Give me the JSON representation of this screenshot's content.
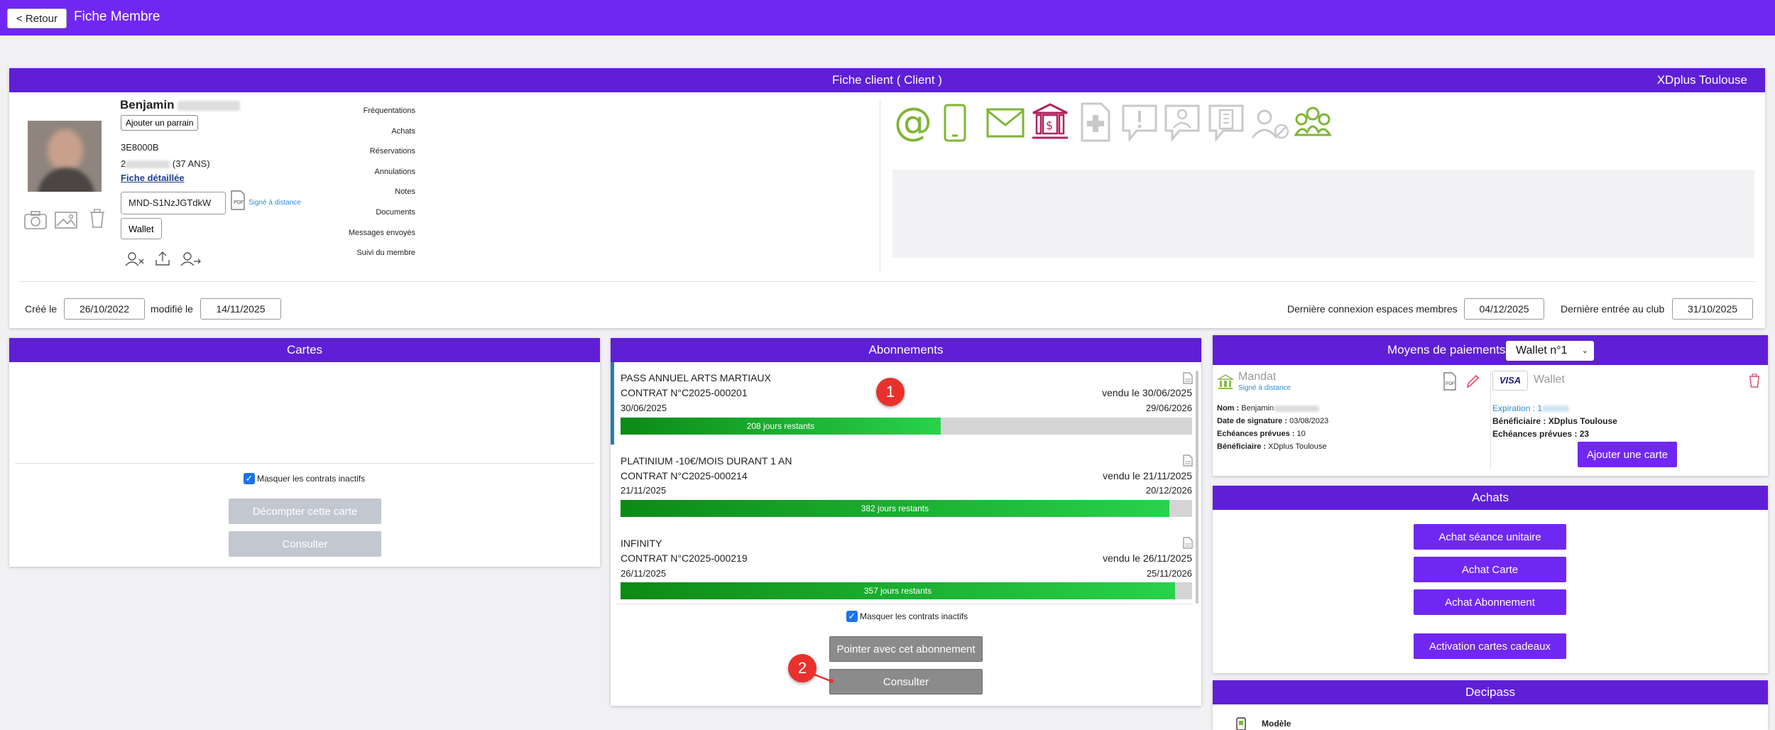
{
  "topbar": {
    "back_label": "< Retour",
    "title": "Fiche Membre"
  },
  "fiche": {
    "header": "Fiche client ( Client )",
    "club": "XDplus Toulouse",
    "name": "Benjamin",
    "parrain_label": "Ajouter un parrain",
    "code": "3E8000B",
    "birth_prefix": "2",
    "age": "(37 ANS)",
    "detail_link": "Fiche détaillée",
    "mandate_ref": "MND-S1NzJGTdkW",
    "signed_label": "Signé à distance",
    "wallet_label": "Wallet",
    "menu": [
      "Fréquentations",
      "Achats",
      "Réservations",
      "Annulations",
      "Notes",
      "Documents",
      "Messages envoyés",
      "Suivi du membre"
    ],
    "created_label": "Créé le",
    "created_date": "26/10/2022",
    "modified_label": "modifié le",
    "modified_date": "14/11/2025",
    "last_login_label": "Dernière connexion espaces membres",
    "last_login_date": "04/12/2025",
    "last_entry_label": "Dernière entrée au club",
    "last_entry_date": "31/10/2025",
    "contact_icons": [
      {
        "name": "email-icon",
        "color": "#7fb536"
      },
      {
        "name": "phone-icon",
        "color": "#7fb536"
      },
      {
        "name": "mail-icon",
        "color": "#7fb536"
      },
      {
        "name": "bank-icon",
        "color": "#b0245e"
      },
      {
        "name": "medical-doc-icon",
        "color": "#c9c9c9"
      },
      {
        "name": "alert-icon",
        "color": "#c9c9c9"
      },
      {
        "name": "contact-icon",
        "color": "#c9c9c9"
      },
      {
        "name": "company-icon",
        "color": "#c9c9c9"
      },
      {
        "name": "user-blocked-icon",
        "color": "#c9c9c9"
      },
      {
        "name": "group-icon",
        "color": "#7fb536"
      }
    ]
  },
  "cartes": {
    "header": "Cartes",
    "hide_inactive": "Masquer les contrats inactifs",
    "decompter": "Décompter cette carte",
    "consulter": "Consulter"
  },
  "abonnements": {
    "header": "Abonnements",
    "items": [
      {
        "title": "PASS ANNUEL ARTS MARTIAUX",
        "contract": "CONTRAT N°C2025-000201",
        "sold": "vendu le 30/06/2025",
        "start": "30/06/2025",
        "end": "29/06/2026",
        "remaining": "208 jours restants",
        "progress": 0.56
      },
      {
        "title": "PLATINIUM -10€/MOIS DURANT 1 AN",
        "contract": "CONTRAT N°C2025-000214",
        "sold": "vendu le 21/11/2025",
        "start": "21/11/2025",
        "end": "20/12/2026",
        "remaining": "382 jours restants",
        "progress": 0.96
      },
      {
        "title": "INFINITY",
        "contract": "CONTRAT N°C2025-000219",
        "sold": "vendu le 26/11/2025",
        "start": "26/11/2025",
        "end": "25/11/2026",
        "remaining": "357 jours restants",
        "progress": 0.97
      }
    ],
    "hide_inactive": "Masquer les contrats inactifs",
    "pointer": "Pointer avec cet abonnement",
    "consulter": "Consulter",
    "marker1": "1",
    "marker2": "2"
  },
  "paiements": {
    "header": "Moyens de paiements",
    "wallet_select": "Wallet n°1",
    "mandat_title": "Mandat",
    "mandat_signed": "Signé à distance",
    "nom_label": "Nom :",
    "nom_value": "Benjamin",
    "signature_label": "Date de signature :",
    "signature_value": "03/08/2023",
    "echeances_label": "Echéances prévues :",
    "echeances_value": "10",
    "benef_label": "Bénéficiaire :",
    "benef_value": "XDplus Toulouse",
    "visa": "VISA",
    "wallet_title": "Wallet",
    "expiration_label": "Expiration :",
    "expiration_value": "1",
    "w_benef_label": "Bénéficiaire :",
    "w_benef_value": "XDplus Toulouse",
    "w_echeances_label": "Echéances prévues :",
    "w_echeances_value": "23",
    "add_card": "Ajouter une carte"
  },
  "achats": {
    "header": "Achats",
    "buttons": [
      "Achat séance unitaire",
      "Achat Carte",
      "Achat Abonnement",
      "Activation cartes cadeaux"
    ]
  },
  "decipass": {
    "header": "Decipass",
    "model_label": "Modèle"
  }
}
